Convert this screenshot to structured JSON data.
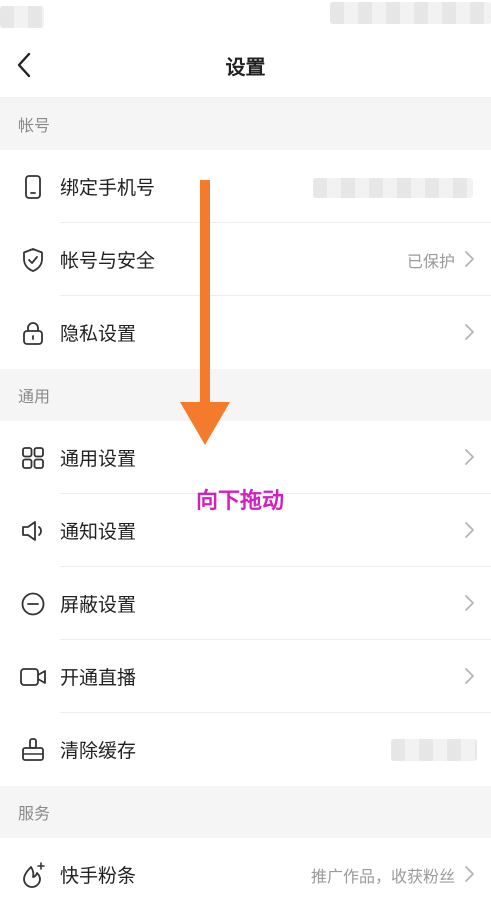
{
  "header": {
    "title": "设置"
  },
  "sections": [
    {
      "title": "帐号",
      "items": [
        {
          "label": "绑定手机号",
          "value": "",
          "icon": "phone-icon"
        },
        {
          "label": "帐号与安全",
          "value": "已保护",
          "icon": "shield-icon"
        },
        {
          "label": "隐私设置",
          "value": "",
          "icon": "lock-icon"
        }
      ]
    },
    {
      "title": "通用",
      "items": [
        {
          "label": "通用设置",
          "value": "",
          "icon": "grid-icon"
        },
        {
          "label": "通知设置",
          "value": "",
          "icon": "speaker-icon"
        },
        {
          "label": "屏蔽设置",
          "value": "",
          "icon": "block-icon"
        },
        {
          "label": "开通直播",
          "value": "",
          "icon": "video-icon"
        },
        {
          "label": "清除缓存",
          "value": "",
          "icon": "broom-icon"
        }
      ]
    },
    {
      "title": "服务",
      "items": [
        {
          "label": "快手粉条",
          "value": "推广作品，收获粉丝",
          "icon": "sparkle-flame-icon"
        }
      ]
    }
  ],
  "annotation": {
    "text": "向下拖动",
    "arrow_color": "#f47a2c",
    "text_color": "#d21fbf"
  }
}
